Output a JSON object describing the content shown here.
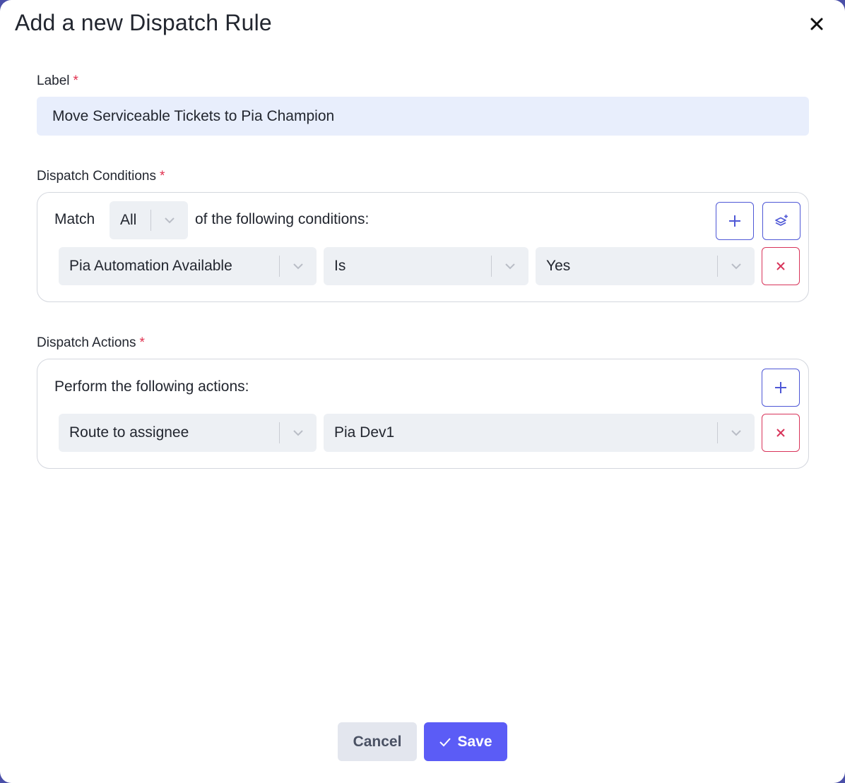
{
  "dialog": {
    "title": "Add a new Dispatch Rule"
  },
  "label_field": {
    "label": "Label",
    "required_mark": "*",
    "value": "Move Serviceable Tickets to Pia Champion"
  },
  "conditions": {
    "label": "Dispatch Conditions",
    "required_mark": "*",
    "match_prefix": "Match",
    "match_value": "All",
    "match_suffix": "of the following conditions:",
    "rows": [
      {
        "field": "Pia Automation Available",
        "operator": "Is",
        "value": "Yes"
      }
    ]
  },
  "actions": {
    "label": "Dispatch Actions",
    "required_mark": "*",
    "intro": "Perform the following actions:",
    "rows": [
      {
        "action": "Route to assignee",
        "target": "Pia Dev1"
      }
    ]
  },
  "footer": {
    "cancel_label": "Cancel",
    "save_label": "Save"
  },
  "colors": {
    "accent": "#5b5cf6",
    "accent_border": "#4e57d6",
    "danger": "#d8345a",
    "input_bg": "#e8eefc",
    "select_bg": "#edf0f4"
  }
}
